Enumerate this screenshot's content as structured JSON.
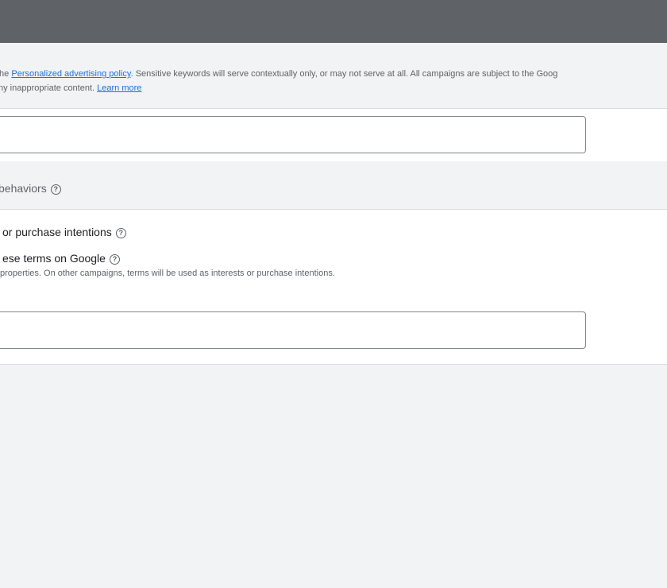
{
  "notice": {
    "line1_prefix": "the ",
    "policy_link": "Personalized advertising policy",
    "line1_suffix": ". Sensitive keywords will serve contextually only, or may not serve at all. All campaigns are subject to the Goog",
    "line2_prefix": "ny inappropriate content. ",
    "learn_more": "Learn more"
  },
  "section": {
    "title": "behaviors"
  },
  "options": {
    "row1_label": "or purchase intentions",
    "row2_label": "ese terms on Google",
    "row2_description": "properties. On other campaigns, terms will be used as interests or purchase intentions."
  },
  "icons": {
    "help": "help-icon"
  }
}
